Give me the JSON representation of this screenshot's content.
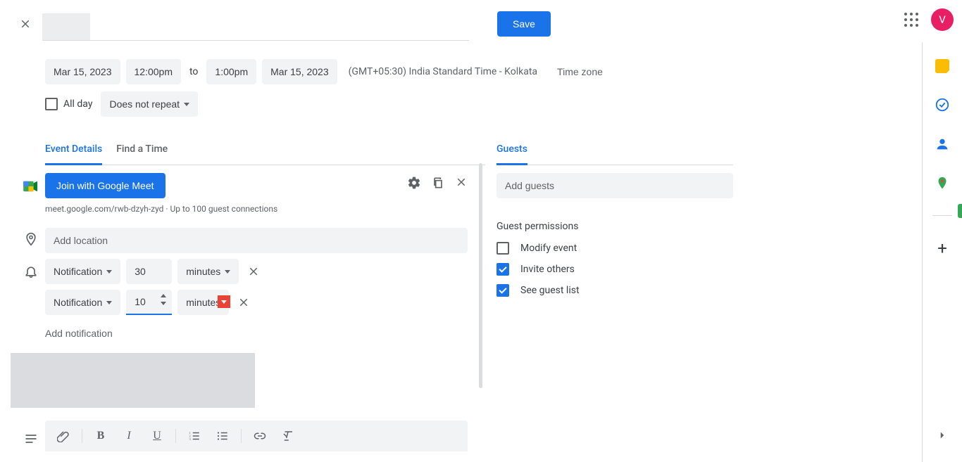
{
  "header": {
    "save_label": "Save",
    "avatar_initial": "V"
  },
  "datetime": {
    "start_date": "Mar 15, 2023",
    "start_time": "12:00pm",
    "to_label": "to",
    "end_time": "1:00pm",
    "end_date": "Mar 15, 2023",
    "tz_text": "(GMT+05:30) India Standard Time - Kolkata",
    "tz_btn": "Time zone"
  },
  "allday": {
    "label": "All day",
    "repeat": "Does not repeat"
  },
  "tabs": {
    "left": [
      {
        "label": "Event Details",
        "active": true
      },
      {
        "label": "Find a Time"
      }
    ]
  },
  "meet": {
    "btn": "Join with Google Meet",
    "sub": "meet.google.com/rwb-dzyh-zyd · Up to 100 guest connections"
  },
  "location": {
    "placeholder": "Add location"
  },
  "notifications": [
    {
      "type": "Notification",
      "value": "30",
      "unit": "minutes"
    },
    {
      "type": "Notification",
      "value": "10",
      "unit": "minutes",
      "active": true
    }
  ],
  "add_notification_label": "Add notification",
  "guests": {
    "tab": "Guests",
    "add_placeholder": "Add guests",
    "permissions_title": "Guest permissions",
    "permissions": [
      {
        "label": "Modify event",
        "checked": false
      },
      {
        "label": "Invite others",
        "checked": true
      },
      {
        "label": "See guest list",
        "checked": true
      }
    ]
  }
}
